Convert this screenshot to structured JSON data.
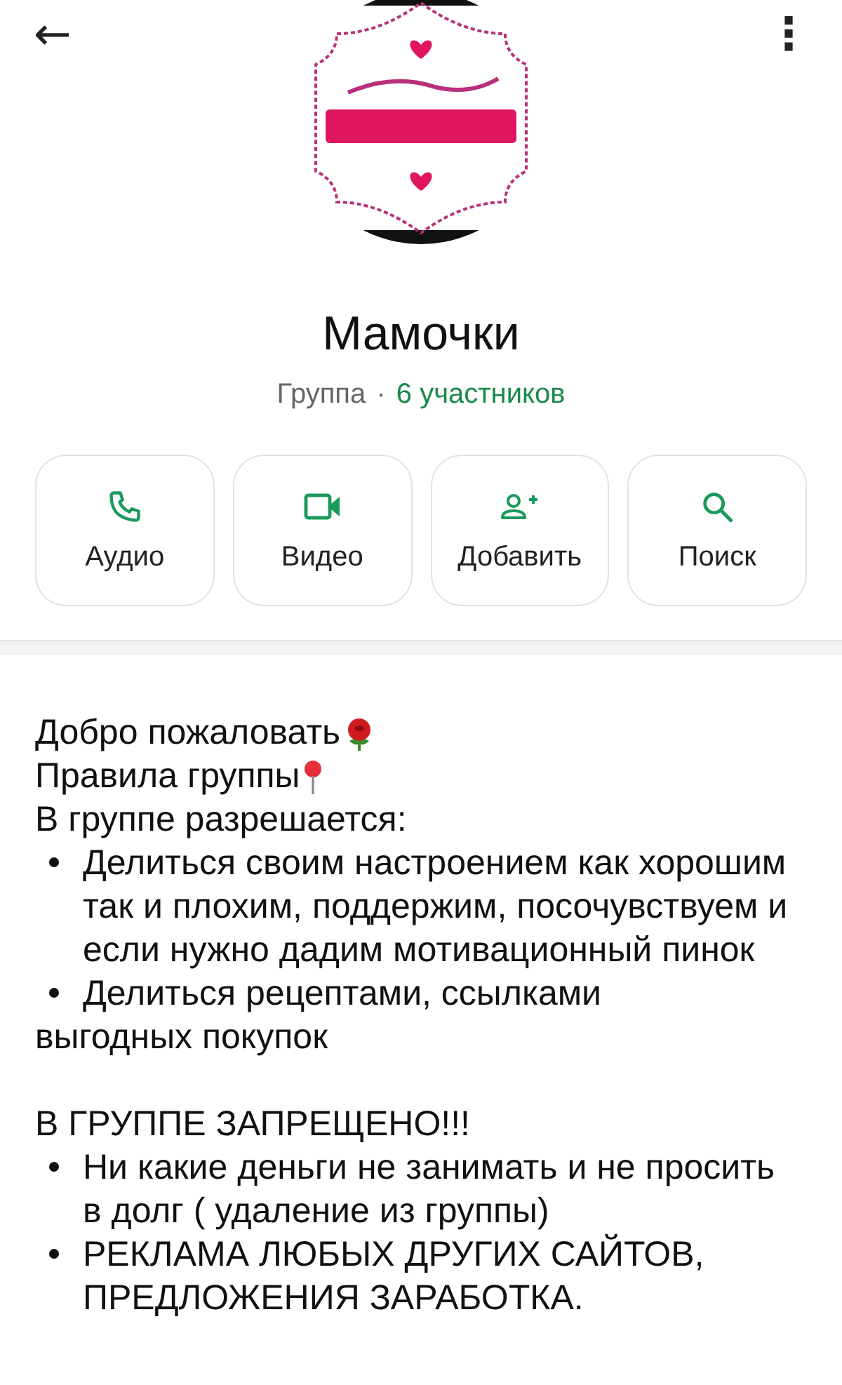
{
  "header": {
    "back": "←",
    "menu": "⋮"
  },
  "group": {
    "name": "Мамочки",
    "type": "Группа",
    "separator": "·",
    "members": "6 участников"
  },
  "actions": [
    {
      "kind": "audio",
      "label": "Аудио"
    },
    {
      "kind": "video",
      "label": "Видео"
    },
    {
      "kind": "add",
      "label": "Добавить"
    },
    {
      "kind": "search",
      "label": "Поиск"
    }
  ],
  "description": {
    "paragraphs": [
      {
        "lines": [
          {
            "kind": "text",
            "text": "Добро пожаловать"
          },
          {
            "kind": "text",
            "text": "Правила группы"
          },
          {
            "kind": "text",
            "text": "В группе разрешается:"
          },
          {
            "kind": "bullet",
            "text": "Делиться своим настроением как хорошим так и плохим, поддержим, посочувствуем и если нужно дадим мотивационный пинок"
          },
          {
            "kind": "bullet",
            "text": "Делиться рецептами, ссылками"
          },
          {
            "kind": "text",
            "text": "выгодных покупок"
          }
        ]
      },
      {
        "lines": [
          {
            "kind": "text",
            "text": "В ГРУППЕ ЗАПРЕЩЕНО!!!"
          },
          {
            "kind": "bullet",
            "text": "Ни какие деньги не занимать и не просить в долг ( удаление из группы)"
          },
          {
            "kind": "bullet",
            "text": "РЕКЛАМА ЛЮБЫХ ДРУГИХ САЙТОВ, ПРЕДЛОЖЕНИЯ ЗАРАБОТКА."
          }
        ]
      }
    ]
  }
}
